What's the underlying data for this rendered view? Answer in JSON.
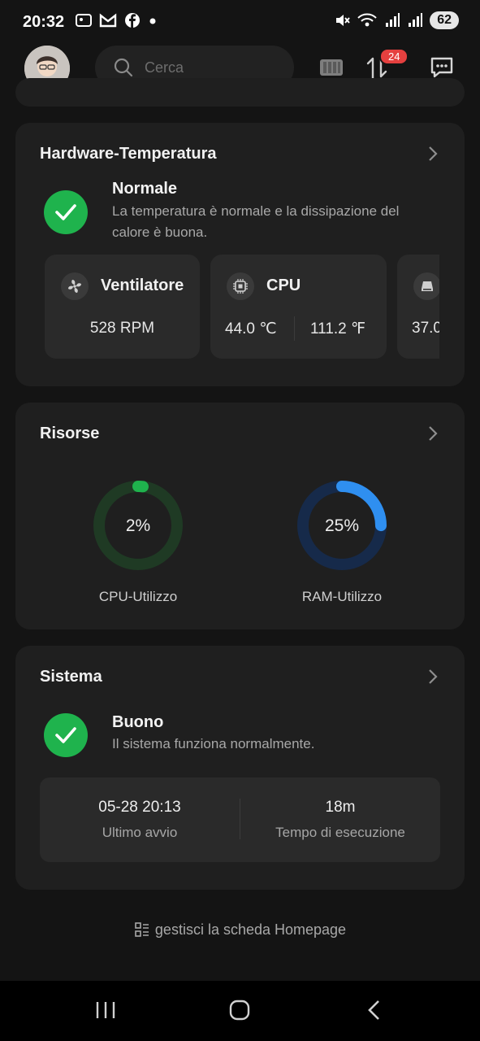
{
  "status_bar": {
    "time": "20:32",
    "battery": "62",
    "left_icons": [
      "photo-notification-icon",
      "gmail-icon",
      "facebook-icon",
      "dot-icon"
    ],
    "right_icons": [
      "mute-icon",
      "wifi-icon",
      "signal-icon",
      "signal-icon"
    ]
  },
  "header": {
    "search_placeholder": "Cerca",
    "notification_count": "24"
  },
  "hardware": {
    "title": "Hardware-Temperatura",
    "status_title": "Normale",
    "status_desc": "La temperatura è normale e la dissipazione del calore è buona.",
    "fan": {
      "label": "Ventilatore",
      "value": "528 RPM"
    },
    "cpu": {
      "label": "CPU",
      "celsius": "44.0 ℃",
      "fahrenheit": "111.2 ℉"
    },
    "disk": {
      "value": "37.0"
    }
  },
  "resources": {
    "title": "Risorse",
    "cpu": {
      "label": "CPU-Utilizzo",
      "value": "2%",
      "percent": 2
    },
    "ram": {
      "label": "RAM-Utilizzo",
      "value": "25%",
      "percent": 25
    }
  },
  "system": {
    "title": "Sistema",
    "status_title": "Buono",
    "status_desc": "Il sistema funziona normalmente.",
    "last_boot_value": "05-28 20:13",
    "last_boot_label": "Ultimo avvio",
    "uptime_value": "18m",
    "uptime_label": "Tempo di esecuzione"
  },
  "footer": {
    "manage_label": "gestisci la scheda Homepage"
  },
  "colors": {
    "accent_green": "#1fb34d",
    "ring_blue": "#2f8ff0",
    "badge_red": "#e5403f"
  }
}
